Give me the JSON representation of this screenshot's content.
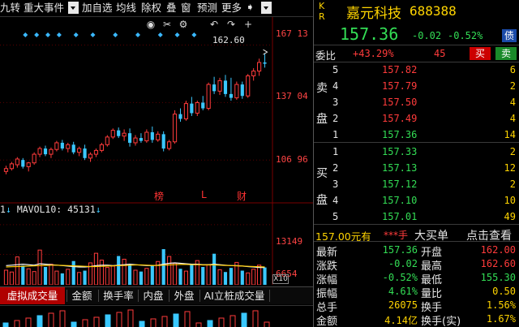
{
  "toolbar": {
    "items": [
      "九转",
      "重大事件",
      "加自选",
      "均线",
      "除权",
      "叠",
      "窗",
      "预测",
      "更多"
    ],
    "more_icon": "arrow-right-icon"
  },
  "chart_tools": [
    "eye-icon",
    "scissors-icon",
    "gear-icon",
    "undo-icon",
    "redo-icon",
    "plus-icon"
  ],
  "chart_data": [
    {
      "type": "candlestick",
      "y_axis_labels": [
        "167 13",
        "137 04",
        "106 96"
      ],
      "y_axis_values": [
        167.13,
        137.04,
        106.96
      ],
      "ylim": [
        85,
        172
      ],
      "high_label": "162.60",
      "high_value": 162.6,
      "bottom_markers": [
        "榜",
        "L",
        "财"
      ],
      "up_color": "#ff3b3b",
      "down_color": "#3ac8ff",
      "candles": [
        {
          "o": 101.0,
          "h": 104.0,
          "l": 99.5,
          "c": 102.5
        },
        {
          "o": 102.5,
          "h": 106.0,
          "l": 101.5,
          "c": 105.0
        },
        {
          "o": 104.5,
          "h": 108.5,
          "l": 103.0,
          "c": 107.5
        },
        {
          "o": 107.0,
          "h": 108.0,
          "l": 102.5,
          "c": 103.5
        },
        {
          "o": 103.5,
          "h": 106.0,
          "l": 101.0,
          "c": 105.5
        },
        {
          "o": 105.5,
          "h": 111.0,
          "l": 104.5,
          "c": 110.0
        },
        {
          "o": 110.0,
          "h": 114.0,
          "l": 108.5,
          "c": 113.0
        },
        {
          "o": 113.0,
          "h": 114.5,
          "l": 109.0,
          "c": 110.0
        },
        {
          "o": 110.0,
          "h": 113.5,
          "l": 108.0,
          "c": 112.5
        },
        {
          "o": 112.5,
          "h": 117.0,
          "l": 111.5,
          "c": 116.0
        },
        {
          "o": 116.0,
          "h": 117.5,
          "l": 112.0,
          "c": 113.0
        },
        {
          "o": 113.0,
          "h": 116.0,
          "l": 111.0,
          "c": 115.0
        },
        {
          "o": 115.0,
          "h": 116.5,
          "l": 110.0,
          "c": 111.0
        },
        {
          "o": 111.0,
          "h": 114.0,
          "l": 109.0,
          "c": 113.0
        },
        {
          "o": 113.0,
          "h": 115.0,
          "l": 107.0,
          "c": 108.0
        },
        {
          "o": 108.0,
          "h": 111.0,
          "l": 106.0,
          "c": 110.0
        },
        {
          "o": 110.0,
          "h": 113.0,
          "l": 108.5,
          "c": 112.0
        },
        {
          "o": 112.0,
          "h": 116.0,
          "l": 111.0,
          "c": 115.0
        },
        {
          "o": 115.0,
          "h": 120.0,
          "l": 114.0,
          "c": 119.0
        },
        {
          "o": 119.0,
          "h": 123.5,
          "l": 118.0,
          "c": 122.5
        },
        {
          "o": 122.5,
          "h": 124.0,
          "l": 118.5,
          "c": 119.5
        },
        {
          "o": 119.5,
          "h": 123.0,
          "l": 117.0,
          "c": 121.0
        },
        {
          "o": 121.0,
          "h": 123.5,
          "l": 114.0,
          "c": 116.0
        },
        {
          "o": 116.0,
          "h": 120.0,
          "l": 114.5,
          "c": 118.5
        },
        {
          "o": 118.5,
          "h": 121.0,
          "l": 116.0,
          "c": 117.0
        },
        {
          "o": 117.0,
          "h": 123.0,
          "l": 116.0,
          "c": 121.5
        },
        {
          "o": 121.5,
          "h": 124.5,
          "l": 116.0,
          "c": 117.5
        },
        {
          "o": 117.5,
          "h": 122.0,
          "l": 116.5,
          "c": 120.5
        },
        {
          "o": 120.5,
          "h": 122.0,
          "l": 111.5,
          "c": 113.0
        },
        {
          "o": 113.0,
          "h": 117.5,
          "l": 112.0,
          "c": 116.5
        },
        {
          "o": 116.5,
          "h": 133.0,
          "l": 115.5,
          "c": 131.0
        },
        {
          "o": 131.0,
          "h": 134.0,
          "l": 127.0,
          "c": 128.5
        },
        {
          "o": 128.5,
          "h": 138.0,
          "l": 127.5,
          "c": 136.5
        },
        {
          "o": 136.5,
          "h": 140.0,
          "l": 130.0,
          "c": 131.5
        },
        {
          "o": 131.5,
          "h": 138.0,
          "l": 130.0,
          "c": 137.0
        },
        {
          "o": 137.0,
          "h": 140.5,
          "l": 133.0,
          "c": 134.0
        },
        {
          "o": 134.0,
          "h": 147.5,
          "l": 133.0,
          "c": 146.5
        },
        {
          "o": 146.5,
          "h": 150.5,
          "l": 141.5,
          "c": 143.0
        },
        {
          "o": 143.0,
          "h": 150.0,
          "l": 141.0,
          "c": 148.5
        },
        {
          "o": 148.5,
          "h": 151.5,
          "l": 140.0,
          "c": 141.5
        },
        {
          "o": 141.5,
          "h": 150.0,
          "l": 138.0,
          "c": 139.5
        },
        {
          "o": 139.5,
          "h": 148.0,
          "l": 138.5,
          "c": 146.5
        },
        {
          "o": 146.5,
          "h": 148.0,
          "l": 139.0,
          "c": 140.5
        },
        {
          "o": 140.5,
          "h": 152.0,
          "l": 139.5,
          "c": 151.0
        },
        {
          "o": 151.0,
          "h": 155.0,
          "l": 148.5,
          "c": 153.5
        },
        {
          "o": 153.5,
          "h": 160.0,
          "l": 151.0,
          "c": 158.0
        },
        {
          "o": 158.0,
          "h": 162.6,
          "l": 155.3,
          "c": 157.36
        }
      ]
    },
    {
      "type": "bar",
      "name": "MAVOL10",
      "label_value": "45131",
      "y_axis_labels": [
        "13149",
        "6654"
      ],
      "y_axis_values": [
        13149,
        6654
      ],
      "ylim": [
        0,
        14200
      ],
      "values": [
        3200,
        2800,
        6100,
        4200,
        3500,
        2900,
        7600,
        3900,
        4500,
        3000,
        2500,
        3400,
        5200,
        2700,
        3100,
        4800,
        6900,
        5400,
        3800,
        4100,
        6300,
        5600,
        4400,
        3200,
        2900,
        3600,
        4200,
        5100,
        7800,
        6200,
        4700,
        3500,
        3000,
        4600,
        5300,
        3900,
        4400,
        6800,
        3300,
        2800,
        3700,
        4900,
        3100,
        2600,
        3400,
        4300,
        3800
      ],
      "mavol_line": [
        4200,
        4300,
        4400,
        4500,
        4400,
        4300,
        4600,
        4500,
        4400,
        4300,
        4200,
        4100,
        4000,
        3900,
        3900,
        4000,
        4200,
        4300,
        4300,
        4200,
        4300,
        4400,
        4500,
        4400,
        4300,
        4200,
        4200,
        4300,
        4500,
        4700,
        4800,
        4700,
        4600,
        4500,
        4500,
        4400,
        4400,
        4500,
        4400,
        4300,
        4200,
        4200,
        4100,
        4000,
        3900,
        3800,
        3800
      ],
      "mavol_line2": [
        3900,
        3950,
        4000,
        4050,
        4100,
        4150,
        4200,
        4250,
        4300,
        4300,
        4250,
        4200,
        4150,
        4100,
        4050,
        4000,
        4000,
        4050,
        4100,
        4150,
        4200,
        4250,
        4300,
        4350,
        4350,
        4300,
        4250,
        4250,
        4300,
        4350,
        4400,
        4450,
        4450,
        4400,
        4400,
        4350,
        4350,
        4350,
        4300,
        4250,
        4200,
        4150,
        4100,
        4050,
        4000,
        3950,
        3900
      ]
    }
  ],
  "vol_header": {
    "prefix": "1",
    "label": "MAVOL10: 45131"
  },
  "tabs": [
    "虚拟成交量",
    "金额",
    "换手率",
    "内盘",
    "外盘",
    "AI立桩成交量"
  ],
  "tabs_active": "虚拟成交量",
  "quote": {
    "k_label": "K",
    "r_label": "R",
    "name": "嘉元科技",
    "code": "688388",
    "price": "157.36",
    "change": "-0.02",
    "change_pct": "-0.52%",
    "debt_badge": "债",
    "weibi_label": "委比",
    "weibi_value": "+43.29%",
    "weicha_value": "45",
    "buy_button": "买",
    "sell_button": "卖",
    "sell_side_chars": [
      "卖",
      "盘"
    ],
    "buy_side_chars": [
      "买",
      "盘"
    ],
    "asks": [
      {
        "level": "5",
        "price": "157.82",
        "volume": "6"
      },
      {
        "level": "4",
        "price": "157.79",
        "volume": "2"
      },
      {
        "level": "3",
        "price": "157.50",
        "volume": "4"
      },
      {
        "level": "2",
        "price": "157.49",
        "volume": "4"
      },
      {
        "level": "1",
        "price": "157.36",
        "volume": "14"
      }
    ],
    "bids": [
      {
        "level": "1",
        "price": "157.33",
        "volume": "2"
      },
      {
        "level": "2",
        "price": "157.13",
        "volume": "12"
      },
      {
        "level": "3",
        "price": "157.12",
        "volume": "2"
      },
      {
        "level": "4",
        "price": "157.10",
        "volume": "10"
      },
      {
        "level": "5",
        "price": "157.01",
        "volume": "49"
      }
    ],
    "bigorder": {
      "price": "157.00元有",
      "stars": "***手",
      "label": "大买单",
      "link": "点击查看"
    },
    "stats": [
      {
        "l1": "最新",
        "v1": "157.36",
        "c1": "green",
        "l2": "开盘",
        "v2": "162.00",
        "c2": "red"
      },
      {
        "l1": "涨跌",
        "v1": "-0.02",
        "c1": "green",
        "l2": "最高",
        "v2": "162.60",
        "c2": "red"
      },
      {
        "l1": "涨幅",
        "v1": "-0.52%",
        "c1": "green",
        "l2": "最低",
        "v2": "155.30",
        "c2": "green"
      },
      {
        "l1": "振幅",
        "v1": "4.61%",
        "c1": "green",
        "l2": "量比",
        "v2": "0.50",
        "c2": "yellow"
      },
      {
        "l1": "总手",
        "v1": "26075",
        "c1": "yellow",
        "l2": "换手",
        "v2": "1.56%",
        "c2": "yellow"
      },
      {
        "l1": "金额",
        "v1": "4.14亿",
        "c1": "yellow",
        "l2": "换手(实)",
        "v2": "1.67%",
        "c2": "yellow"
      }
    ]
  }
}
